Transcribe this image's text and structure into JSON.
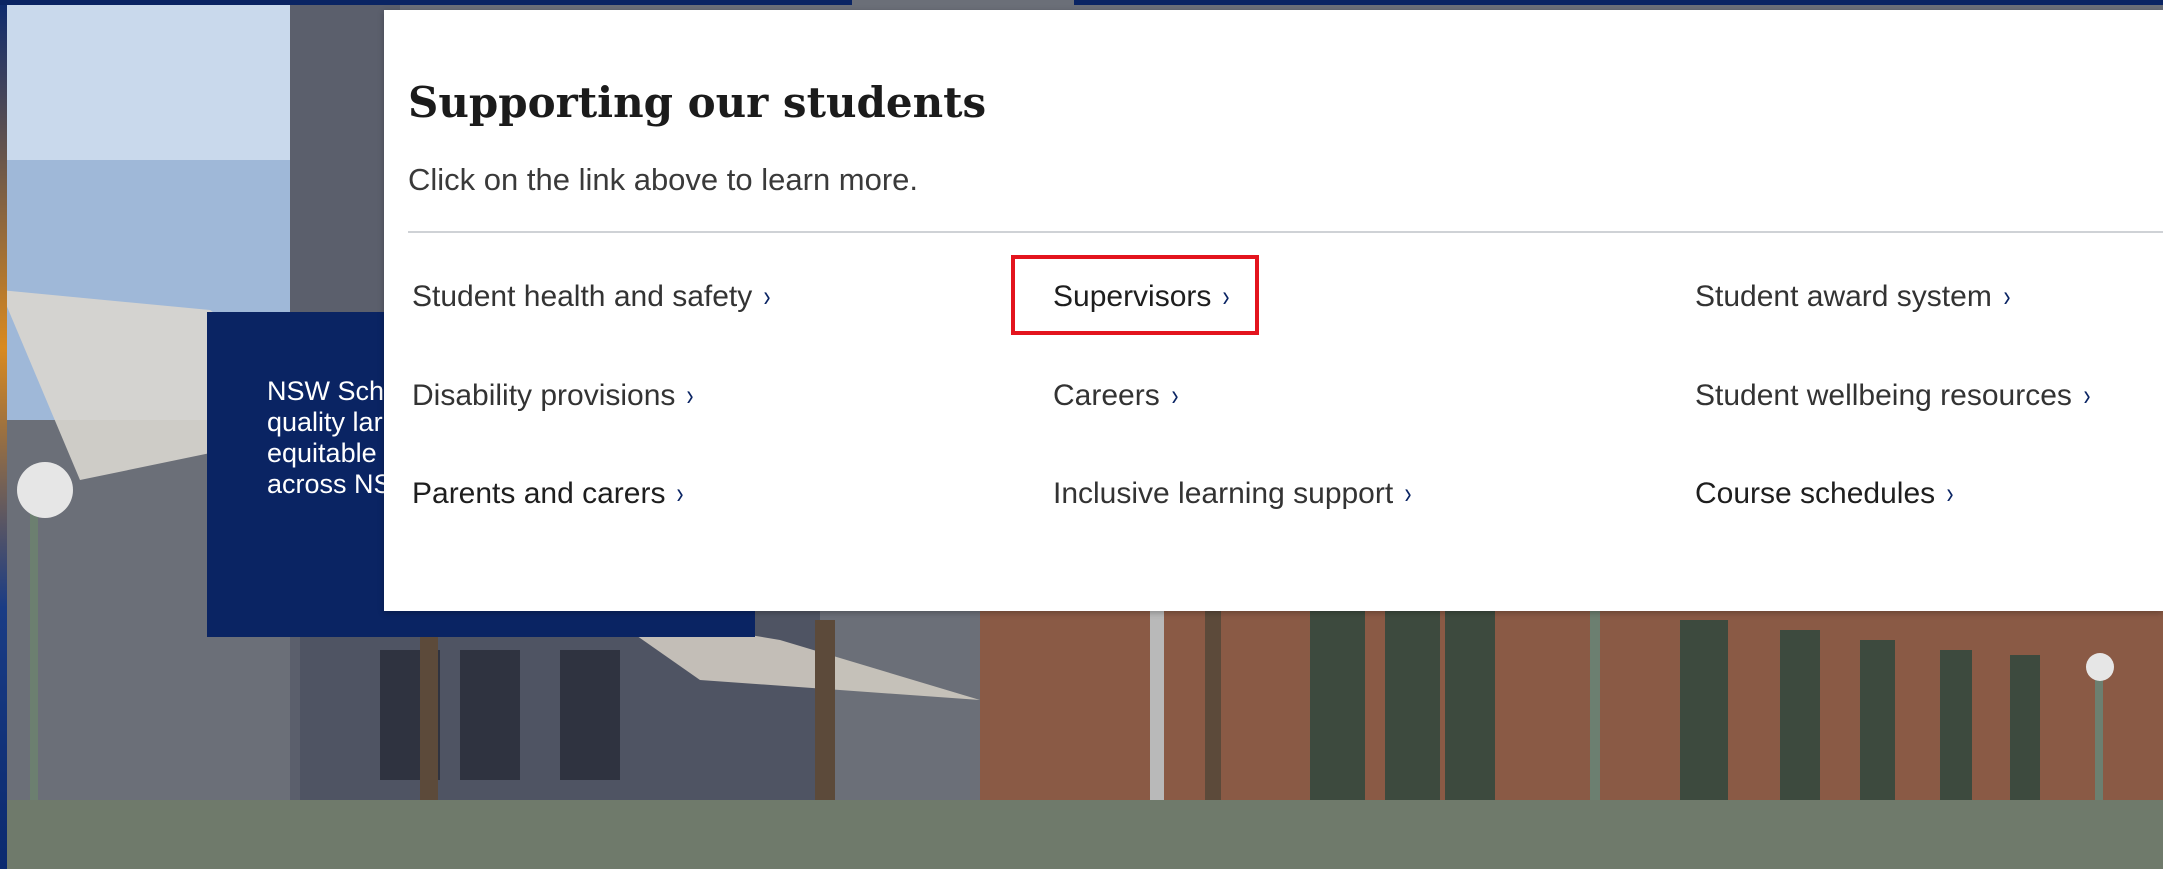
{
  "menu": {
    "title": "Supporting our students",
    "subtitle": "Click on the link above to learn more.",
    "links": [
      {
        "label": "Student health and safety",
        "chevron": "›"
      },
      {
        "label": "Supervisors",
        "chevron": "›"
      },
      {
        "label": "Student award system",
        "chevron": "›"
      },
      {
        "label": "Disability provisions",
        "chevron": "›"
      },
      {
        "label": "Careers",
        "chevron": "›"
      },
      {
        "label": "Student wellbeing resources",
        "chevron": "›"
      },
      {
        "label": "Parents and carers",
        "chevron": "›"
      },
      {
        "label": "Inclusive learning support",
        "chevron": "›"
      },
      {
        "label": "Course schedules",
        "chevron": "›"
      }
    ]
  },
  "hero": {
    "lines": [
      "NSW Scho",
      "quality lar",
      "equitable",
      "across NS"
    ]
  },
  "colors": {
    "navy": "#0a2463",
    "highlight": "#e3141d"
  }
}
